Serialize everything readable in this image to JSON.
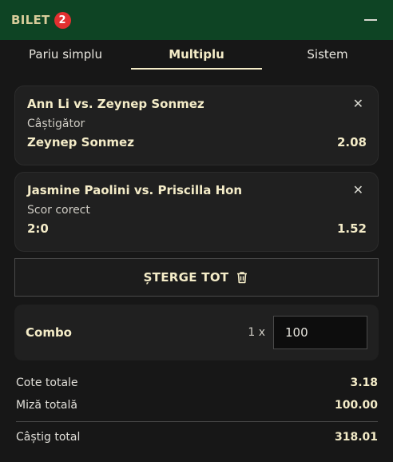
{
  "header": {
    "title": "BILET",
    "badge": "2"
  },
  "tabs": [
    {
      "label": "Pariu simplu",
      "active": false
    },
    {
      "label": "Multiplu",
      "active": true
    },
    {
      "label": "Sistem",
      "active": false
    }
  ],
  "bets": [
    {
      "event": "Ann Li vs. Zeynep Sonmez",
      "market": "Câștigător",
      "pick": "Zeynep Sonmez",
      "odds": "2.08"
    },
    {
      "event": "Jasmine Paolini vs. Priscilla Hon",
      "market": "Scor corect",
      "pick": "2:0",
      "odds": "1.52"
    }
  ],
  "clear_all": {
    "label": "ȘTERGE TOT"
  },
  "combo": {
    "label": "Combo",
    "multiplier": "1 x",
    "stake": "100"
  },
  "summary": {
    "total_odds_label": "Cote totale",
    "total_odds": "3.18",
    "total_stake_label": "Miză totală",
    "total_stake": "100.00",
    "total_win_label": "Câștig total",
    "total_win": "318.01"
  },
  "colors": {
    "header_bg": "#0e4424",
    "accent_text": "#f4ecc8",
    "badge": "#e23030"
  }
}
